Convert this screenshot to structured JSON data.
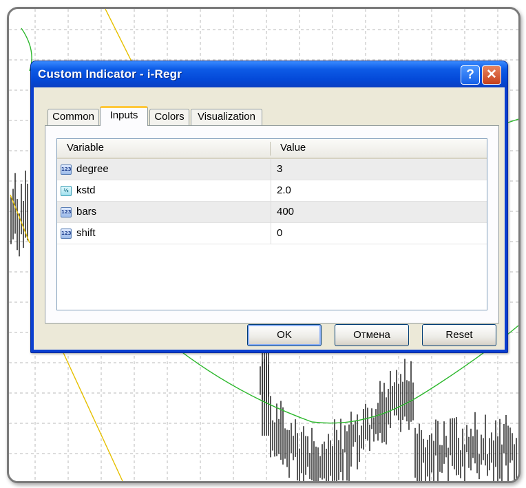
{
  "dialog": {
    "title": "Custom Indicator - i-Regr",
    "help_glyph": "?",
    "close_glyph": "✕"
  },
  "tabs": [
    {
      "label": "Common",
      "active": false
    },
    {
      "label": "Inputs",
      "active": true
    },
    {
      "label": "Colors",
      "active": false
    },
    {
      "label": "Visualization",
      "active": false
    }
  ],
  "table": {
    "columns": [
      "Variable",
      "Value"
    ],
    "rows": [
      {
        "icon": "int-type-icon",
        "icon_text": "123",
        "name": "degree",
        "value": "3"
      },
      {
        "icon": "double-type-icon",
        "icon_text": "½",
        "name": "kstd",
        "value": "2.0"
      },
      {
        "icon": "int-type-icon",
        "icon_text": "123",
        "name": "bars",
        "value": "400"
      },
      {
        "icon": "int-type-icon",
        "icon_text": "123",
        "name": "shift",
        "value": "0"
      }
    ]
  },
  "buttons": {
    "ok": "OK",
    "cancel": "Отмена",
    "reset": "Reset"
  },
  "colors": {
    "title_bar": "#0d5be6",
    "regression_curve": "#2db82d",
    "channel_line": "#e6c000",
    "candles": "#000000",
    "grid": "#b8b8b8"
  }
}
